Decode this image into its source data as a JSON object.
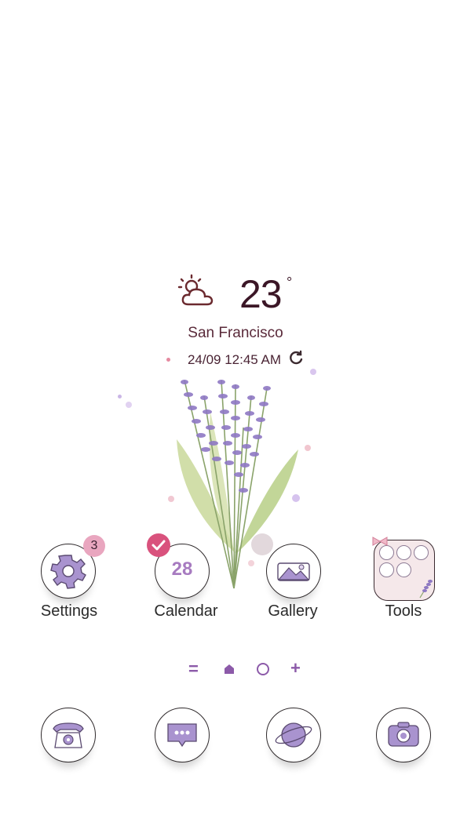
{
  "weather": {
    "temperature": "23",
    "degree_symbol": "°",
    "city": "San Francisco",
    "datetime": "24/09 12:45 AM",
    "icon": "sun-cloud-icon"
  },
  "home_apps": [
    {
      "label": "Settings",
      "badge": "3",
      "icon": "gear-icon"
    },
    {
      "label": "Calendar",
      "date": "28",
      "icon": "calendar-icon"
    },
    {
      "label": "Gallery",
      "icon": "image-icon"
    },
    {
      "label": "Tools",
      "icon": "folder-icon"
    }
  ],
  "page_indicator": [
    "=",
    "home",
    "○",
    "+"
  ],
  "dock": [
    {
      "icon": "phone-icon"
    },
    {
      "icon": "message-icon"
    },
    {
      "icon": "browser-icon"
    },
    {
      "icon": "camera-icon"
    }
  ],
  "colors": {
    "accent": "#a77bc0",
    "badge": "#e9a6bf",
    "check": "#d9527d"
  }
}
